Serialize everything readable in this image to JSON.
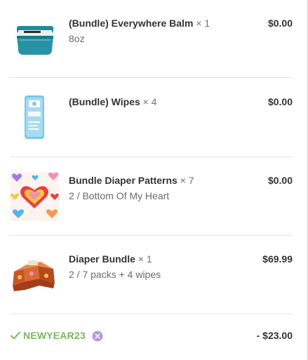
{
  "line_items": [
    {
      "image": "everywhere-balm-jar",
      "name": "(Bundle) Everywhere Balm",
      "quantity": "× 1",
      "variant": "8oz",
      "price": "$0.00"
    },
    {
      "image": "wipes-pack",
      "name": "(Bundle) Wipes",
      "quantity": "× 4",
      "variant": "",
      "price": "$0.00"
    },
    {
      "image": "hearts-pattern-swatch",
      "name": "Bundle Diaper Patterns",
      "quantity": "× 7",
      "variant": "2 / Bottom Of My Heart",
      "price": "$0.00"
    },
    {
      "image": "diaper-bundle-box",
      "name": "Diaper Bundle",
      "quantity": "× 1",
      "variant": "2 / 7 packs + 4 wipes",
      "price": "$69.99"
    }
  ],
  "discount": {
    "icon": "check-icon",
    "code": "NEWYEAR23",
    "remove_icon": "remove-circle-icon",
    "amount": "- $23.00"
  },
  "colors": {
    "discount_green": "#7ab55c",
    "remove_purple": "#b69ad8",
    "text_dark": "#333333",
    "text_muted": "#717171"
  }
}
